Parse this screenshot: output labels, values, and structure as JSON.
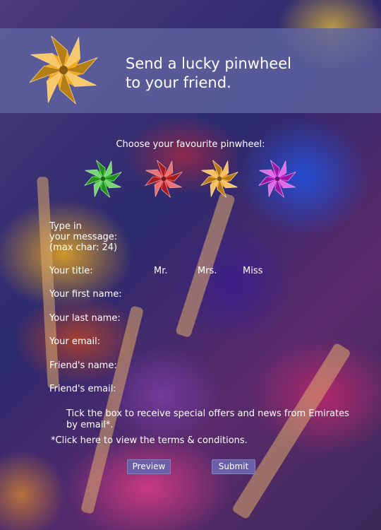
{
  "header": {
    "headline_line1": "Send a lucky pinwheel",
    "headline_line2": "to your friend."
  },
  "choose": {
    "label": "Choose your favourite pinwheel:",
    "pinwheels": [
      {
        "name": "green-pinwheel",
        "color": "#2fbf2a"
      },
      {
        "name": "red-pinwheel",
        "color": "#d8262a"
      },
      {
        "name": "orange-pinwheel",
        "color": "#f0a11c"
      },
      {
        "name": "purple-pinwheel",
        "color": "#c81fd8"
      }
    ]
  },
  "form": {
    "message_line1": "Type in",
    "message_line2": "your message:",
    "message_line3": "(max char: 24)",
    "title_label": "Your title:",
    "title_options": [
      "Mr.",
      "Mrs.",
      "Miss"
    ],
    "first_name_label": "Your first name:",
    "last_name_label": "Your last name:",
    "email_label": "Your email:",
    "friend_name_label": "Friend's name:",
    "friend_email_label": "Friend's email:",
    "offers_line1": "Tick the box to receive special offers and news from Emirates",
    "offers_line2": "by email*.",
    "terms_link": "*Click here to view the terms & conditions.",
    "preview_label": "Preview",
    "submit_label": "Submit"
  },
  "colors": {
    "logo_pinwheel": "#f2a91c",
    "header_band": "#5f64a0",
    "button": "#6a5fa8"
  }
}
